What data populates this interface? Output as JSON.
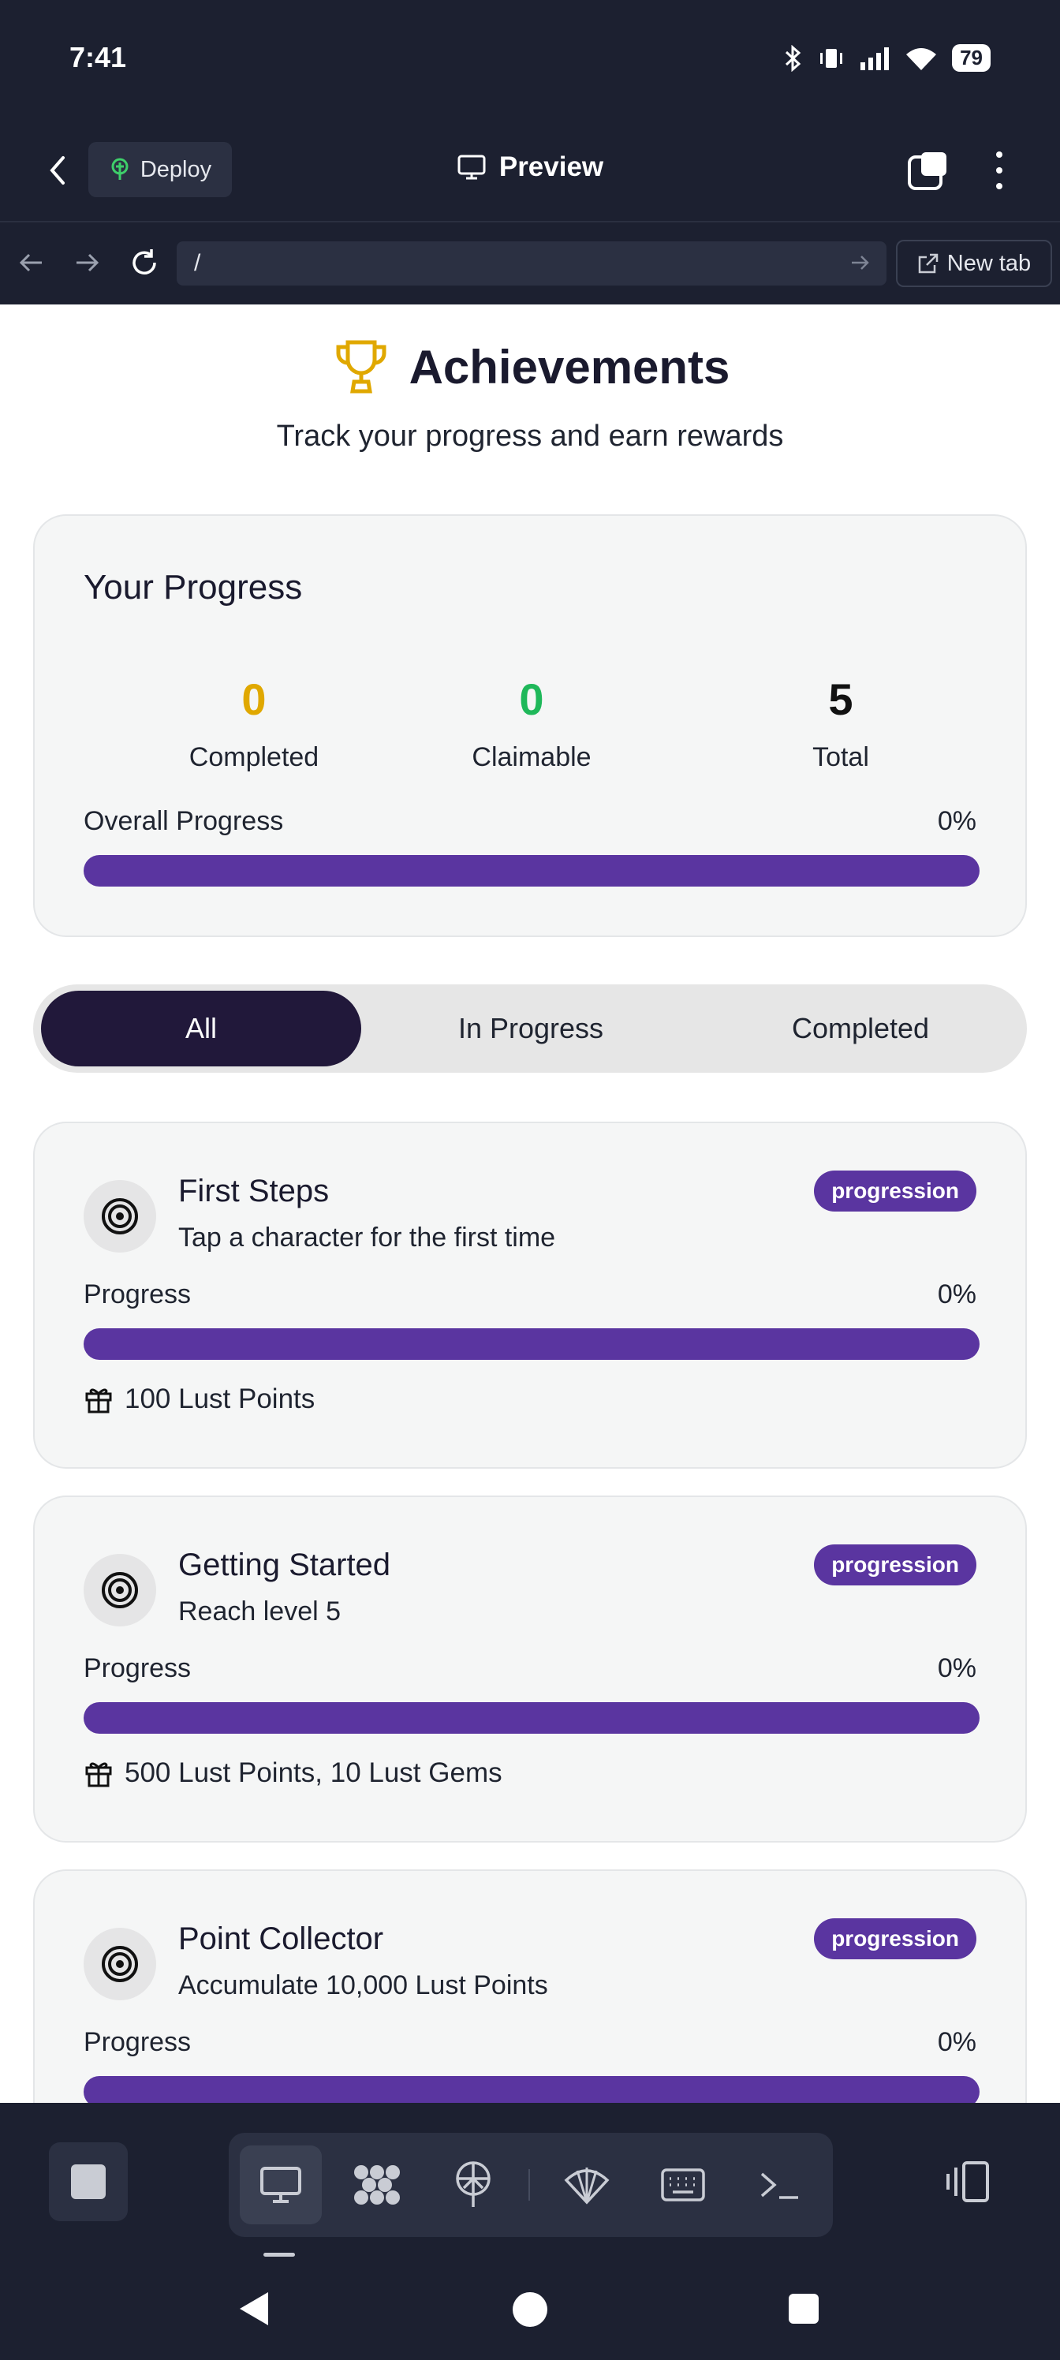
{
  "status_bar": {
    "time": "7:41",
    "battery": "79"
  },
  "app_bar": {
    "deploy_label": "Deploy",
    "title": "Preview"
  },
  "url_bar": {
    "path": "/",
    "new_tab_label": "New tab"
  },
  "page": {
    "title": "Achievements",
    "subtitle": "Track your progress and earn rewards",
    "progress_card": {
      "title": "Your Progress",
      "completed": {
        "value": "0",
        "label": "Completed",
        "color": "#e0a800"
      },
      "claimable": {
        "value": "0",
        "label": "Claimable",
        "color": "#1fb85a"
      },
      "total": {
        "value": "5",
        "label": "Total",
        "color": "#111111"
      },
      "overall_label": "Overall Progress",
      "overall_percent": "0%",
      "overall_fraction": 0
    },
    "filters": [
      {
        "label": "All",
        "active": true
      },
      {
        "label": "In Progress",
        "active": false
      },
      {
        "label": "Completed",
        "active": false
      }
    ],
    "achievements": [
      {
        "name": "First Steps",
        "description": "Tap a character for the first time",
        "category": "progression",
        "progress_label": "Progress",
        "percent": "0%",
        "fraction": 0,
        "reward": "100 Lust Points",
        "icon": "target-icon"
      },
      {
        "name": "Getting Started",
        "description": "Reach level 5",
        "category": "progression",
        "progress_label": "Progress",
        "percent": "0%",
        "fraction": 0,
        "reward": "500 Lust Points, 10 Lust Gems",
        "icon": "target-icon"
      },
      {
        "name": "Point Collector",
        "description": "Accumulate 10,000 Lust Points",
        "category": "progression",
        "progress_label": "Progress",
        "percent": "0%",
        "fraction": 0,
        "reward": "",
        "icon": "target-icon"
      }
    ]
  },
  "colors": {
    "accent_purple": "#5a35a0",
    "active_tab": "#21183a",
    "trophy": "#e0a800"
  }
}
